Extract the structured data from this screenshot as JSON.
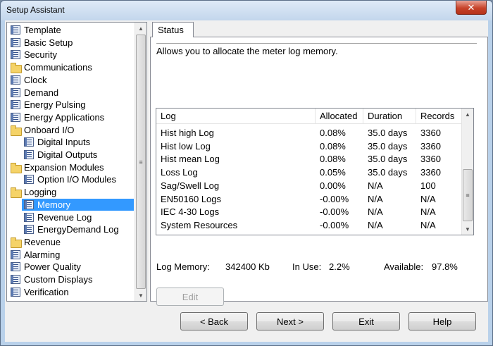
{
  "window": {
    "title": "Setup Assistant",
    "close_glyph": "✕"
  },
  "tree": {
    "items": [
      {
        "label": "Template",
        "icon": "page-icon",
        "indent": 0
      },
      {
        "label": "Basic Setup",
        "icon": "page-icon",
        "indent": 0
      },
      {
        "label": "Security",
        "icon": "page-icon",
        "indent": 0
      },
      {
        "label": "Communications",
        "icon": "folder-icon",
        "indent": 0
      },
      {
        "label": "Clock",
        "icon": "page-icon",
        "indent": 0
      },
      {
        "label": "Demand",
        "icon": "page-icon",
        "indent": 0
      },
      {
        "label": "Energy Pulsing",
        "icon": "page-icon",
        "indent": 0
      },
      {
        "label": "Energy Applications",
        "icon": "page-icon",
        "indent": 0
      },
      {
        "label": "Onboard I/O",
        "icon": "folder-icon",
        "indent": 0
      },
      {
        "label": "Digital Inputs",
        "icon": "page-icon",
        "indent": 1
      },
      {
        "label": "Digital Outputs",
        "icon": "page-icon",
        "indent": 1
      },
      {
        "label": "Expansion Modules",
        "icon": "folder-icon",
        "indent": 0
      },
      {
        "label": "Option I/O Modules",
        "icon": "page-icon",
        "indent": 1
      },
      {
        "label": "Logging",
        "icon": "folder-icon",
        "indent": 0
      },
      {
        "label": "Memory",
        "icon": "page-icon",
        "indent": 1,
        "selected": true
      },
      {
        "label": "Revenue Log",
        "icon": "page-icon",
        "indent": 1
      },
      {
        "label": "EnergyDemand Log",
        "icon": "page-icon",
        "indent": 1
      },
      {
        "label": "Revenue",
        "icon": "folder-icon",
        "indent": 0
      },
      {
        "label": "Alarming",
        "icon": "page-icon",
        "indent": 0
      },
      {
        "label": "Power Quality",
        "icon": "page-icon",
        "indent": 0
      },
      {
        "label": "Custom Displays",
        "icon": "page-icon",
        "indent": 0
      },
      {
        "label": "Verification",
        "icon": "page-icon",
        "indent": 0
      }
    ]
  },
  "tab": {
    "label": "Status"
  },
  "description": "Allows you to allocate the meter log memory.",
  "log_table": {
    "columns": [
      "Log",
      "Allocated",
      "Duration",
      "Records"
    ],
    "rows": [
      [
        "Hist high Log",
        "0.08%",
        "35.0 days",
        "3360"
      ],
      [
        "Hist low Log",
        "0.08%",
        "35.0 days",
        "3360"
      ],
      [
        "Hist mean Log",
        "0.08%",
        "35.0 days",
        "3360"
      ],
      [
        "Loss Log",
        "0.05%",
        "35.0 days",
        "3360"
      ],
      [
        "Sag/Swell Log",
        "0.00%",
        "N/A",
        "100"
      ],
      [
        "EN50160 Logs",
        "-0.00%",
        "N/A",
        "N/A"
      ],
      [
        "IEC 4-30 Logs",
        "-0.00%",
        "N/A",
        "N/A"
      ],
      [
        "System Resources",
        "-0.00%",
        "N/A",
        "N/A"
      ]
    ]
  },
  "summary": {
    "log_memory_label": "Log Memory:",
    "log_memory_value": "342400 Kb",
    "in_use_label": "In Use:",
    "in_use_value": "2.2%",
    "available_label": "Available:",
    "available_value": "97.8%"
  },
  "buttons": {
    "edit": "Edit",
    "back": "< Back",
    "next": "Next >",
    "exit": "Exit",
    "help": "Help"
  },
  "scroll_glyphs": {
    "up": "▲",
    "down": "▼",
    "grip": "≡"
  }
}
